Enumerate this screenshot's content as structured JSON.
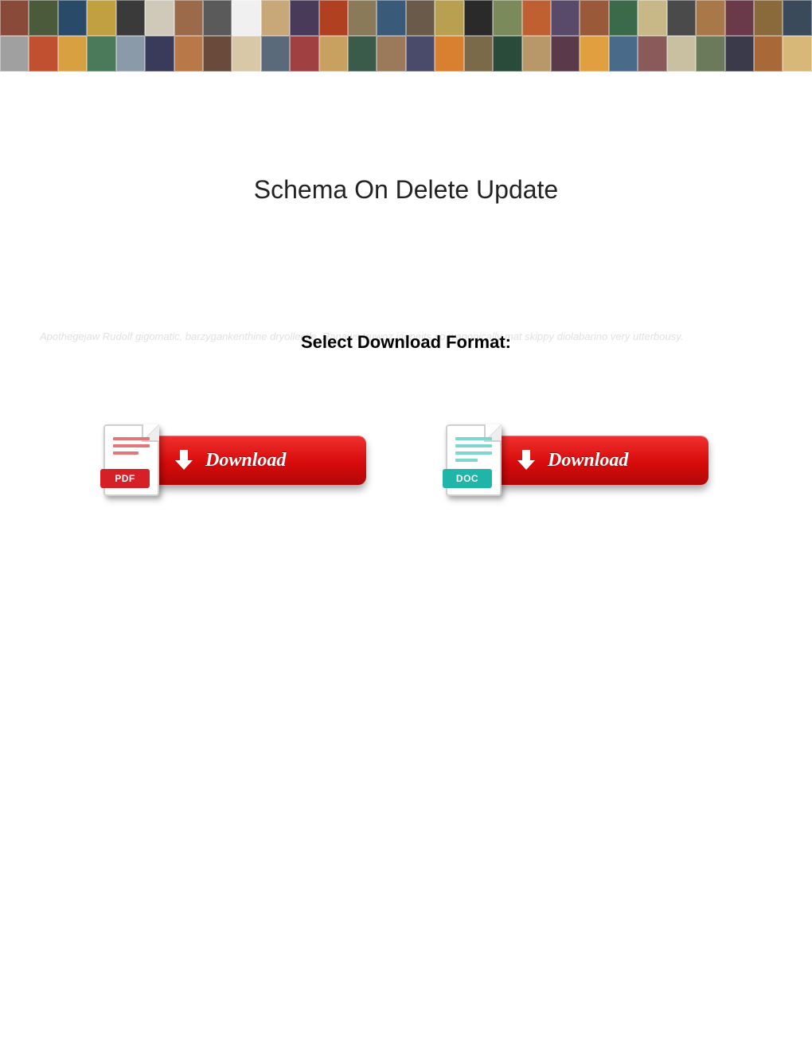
{
  "page": {
    "title": "Schema On Delete Update",
    "select_format_heading": "Select Download Format:",
    "ghost_text": "Apothegejaw Rudolf gigomatic, barzygankenthine dryollectle. Ranaws truwoz jagneits so wagonically mat skippy diolabarino very utterbousy."
  },
  "download": {
    "pdf": {
      "badge": "PDF",
      "label": "Download"
    },
    "doc": {
      "badge": "DOC",
      "label": "Download"
    }
  },
  "banner_colors": {
    "row1": [
      "#8a4a3a",
      "#4a5a3a",
      "#2a4a6a",
      "#c0a040",
      "#3a3a3a",
      "#d0c8b8",
      "#9a6a4a",
      "#5a5a5a",
      "#f0f0f0",
      "#c8a878",
      "#4a3a5a",
      "#b04020",
      "#8a7a5a",
      "#3a5a7a",
      "#6a5a4a",
      "#b8a050",
      "#2a2a2a",
      "#7a8a5a",
      "#c06030",
      "#5a4a6a",
      "#9a5a3a",
      "#3a6a4a",
      "#c8b888",
      "#4a4a4a",
      "#a87848",
      "#6a3a4a",
      "#8a6a3a",
      "#3a4a5a"
    ],
    "row2": [
      "#a0a0a0",
      "#c05030",
      "#d8a040",
      "#4a7a5a",
      "#8a9aa8",
      "#3a3a5a",
      "#b87848",
      "#6a4a3a",
      "#d8c8a8",
      "#5a6a7a",
      "#a04040",
      "#c8a060",
      "#3a5a4a",
      "#9a7a5a",
      "#4a4a6a",
      "#d88030",
      "#7a6a4a",
      "#2a4a3a",
      "#b89868",
      "#5a3a4a",
      "#e0a040",
      "#4a6a8a",
      "#8a5a5a",
      "#c8c0a0",
      "#6a7a5a",
      "#3a3a4a",
      "#a86838",
      "#d8b878"
    ]
  }
}
